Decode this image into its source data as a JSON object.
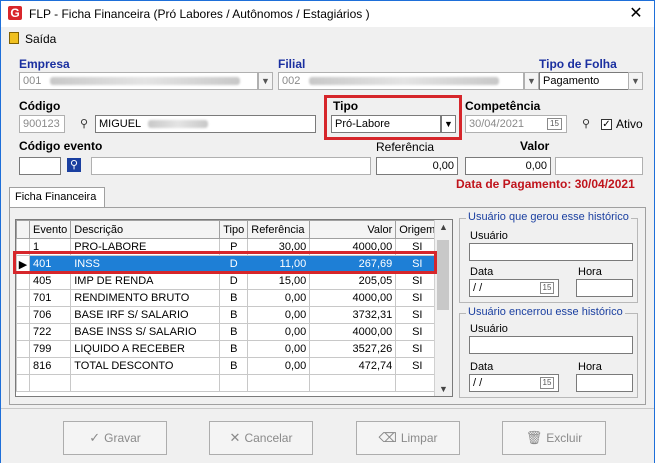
{
  "window": {
    "title": "FLP - Ficha Financeira (Pró Labores / Autônomos / Estagiários )",
    "close_glyph": "✕"
  },
  "menu": {
    "exit_label": "Saída"
  },
  "empresa": {
    "label": "Empresa",
    "code": "001"
  },
  "filial": {
    "label": "Filial",
    "code": "002"
  },
  "tipo_folha": {
    "label": "Tipo de Folha",
    "value": "Pagamento"
  },
  "codigo": {
    "label": "Código",
    "value": "900123",
    "name": "MIGUEL"
  },
  "tipo": {
    "label": "Tipo",
    "value": "Pró-Labore"
  },
  "competencia": {
    "label": "Competência",
    "value": "30/04/2021",
    "cal_label": "15"
  },
  "ativo": {
    "label": "Ativo",
    "checked": true,
    "check_glyph": "✓"
  },
  "codigo_evento": {
    "label": "Código evento"
  },
  "referencia": {
    "label": "Referência",
    "value": "0,00"
  },
  "valor": {
    "label": "Valor",
    "value": "0,00"
  },
  "data_pagamento": "Data de Pagamento: 30/04/2021",
  "tab": {
    "label": "Ficha Financeira"
  },
  "grid": {
    "headers": [
      "Evento",
      "Descrição",
      "Tipo",
      "Referência",
      "Valor",
      "Origem"
    ],
    "rows": [
      [
        "1",
        "PRO-LABORE",
        "P",
        "30,00",
        "4000,00",
        "SI"
      ],
      [
        "401",
        "INSS",
        "D",
        "11,00",
        "267,69",
        "SI"
      ],
      [
        "405",
        "IMP DE RENDA",
        "D",
        "15,00",
        "205,05",
        "SI"
      ],
      [
        "701",
        "RENDIMENTO BRUTO",
        "B",
        "0,00",
        "4000,00",
        "SI"
      ],
      [
        "706",
        "BASE IRF S/ SALARIO",
        "B",
        "0,00",
        "3732,31",
        "SI"
      ],
      [
        "722",
        "BASE INSS S/ SALARIO",
        "B",
        "0,00",
        "4000,00",
        "SI"
      ],
      [
        "799",
        "LIQUIDO A RECEBER",
        "B",
        "0,00",
        "3527,26",
        "SI"
      ],
      [
        "816",
        "TOTAL DESCONTO",
        "B",
        "0,00",
        "472,74",
        "SI"
      ]
    ],
    "selected_row": 1,
    "row_pointer": "▶",
    "scroll_up": "▲",
    "scroll_down": "▼"
  },
  "hist_gerou": {
    "title": "Usuário que gerou esse histórico",
    "usuario_label": "Usuário",
    "data_label": "Data",
    "hora_label": "Hora",
    "data_value": "/ /",
    "cal_label": "15"
  },
  "hist_encerrou": {
    "title": "Usuário encerrou esse histórico",
    "usuario_label": "Usuário",
    "data_label": "Data",
    "hora_label": "Hora",
    "data_value": "/ /",
    "cal_label": "15"
  },
  "buttons": {
    "gravar": {
      "label": "Gravar",
      "icon": "✓"
    },
    "cancelar": {
      "label": "Cancelar",
      "icon": "✕"
    },
    "limpar": {
      "label": "Limpar",
      "icon": "⌫"
    },
    "excluir": {
      "label": "Excluir",
      "icon": "🗑"
    }
  },
  "colors": {
    "selection": "#1e7fd6",
    "highlight_red": "#d6262b",
    "label_blue": "#1a2fa0",
    "date_red": "#c0141c"
  }
}
